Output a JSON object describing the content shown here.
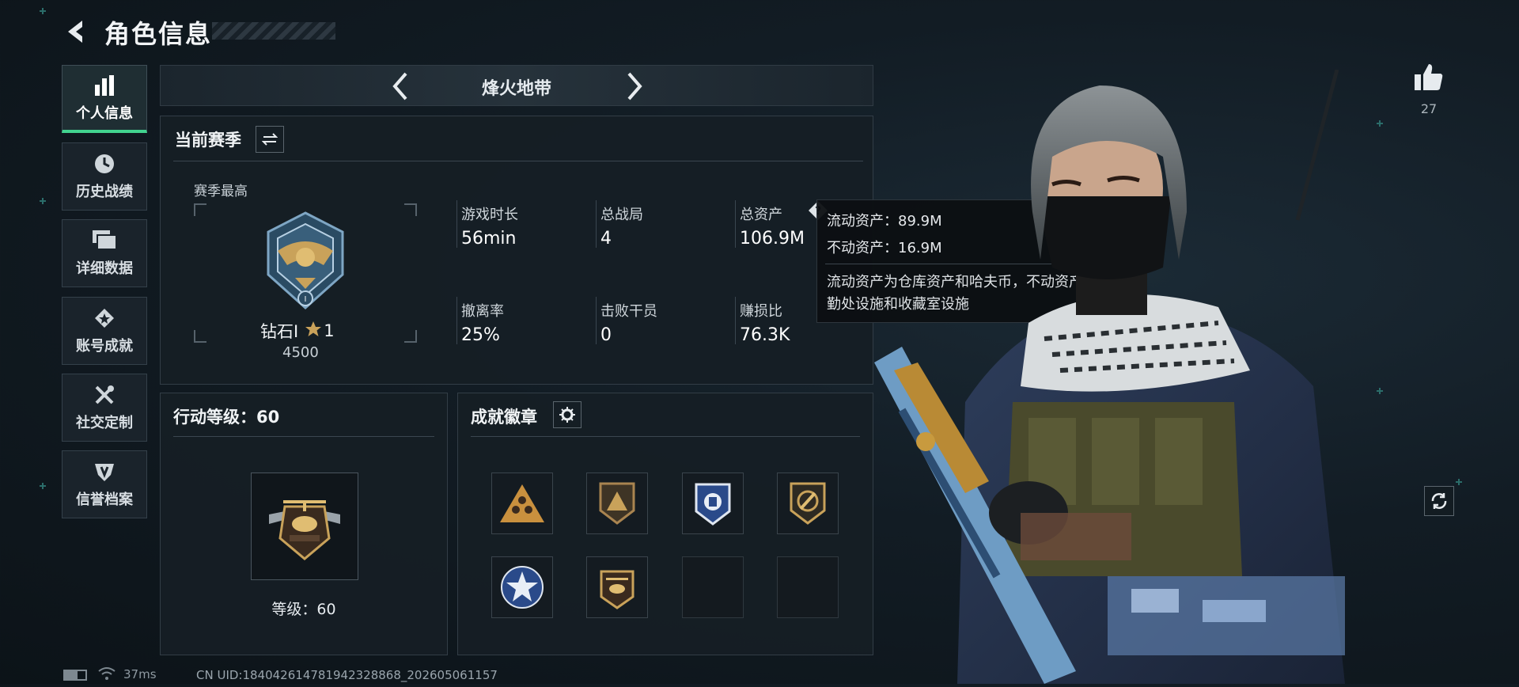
{
  "header": {
    "title": "角色信息"
  },
  "nav": {
    "items": [
      {
        "label": "个人信息",
        "icon": "bar-chart-icon",
        "active": true
      },
      {
        "label": "历史战绩",
        "icon": "history-clock-icon",
        "active": false
      },
      {
        "label": "详细数据",
        "icon": "folder-icon",
        "active": false
      },
      {
        "label": "账号成就",
        "icon": "achievement-icon",
        "active": false
      },
      {
        "label": "社交定制",
        "icon": "tools-icon",
        "active": false
      },
      {
        "label": "信誉档案",
        "icon": "shield-icon",
        "active": false
      }
    ]
  },
  "mode": {
    "title": "烽火地带"
  },
  "season": {
    "title": "当前赛季",
    "best_label": "赛季最高",
    "rank_name": "钻石I",
    "stars": "1",
    "score": "4500",
    "stats": [
      {
        "label": "游戏时长",
        "value": "56min"
      },
      {
        "label": "总战局",
        "value": "4"
      },
      {
        "label": "总资产",
        "value": "106.9M"
      },
      {
        "label": "撤离率",
        "value": "25%"
      },
      {
        "label": "击败干员",
        "value": "0"
      },
      {
        "label": "赚损比",
        "value": "76.3K"
      }
    ]
  },
  "tooltip": {
    "liquid": "流动资产：89.9M",
    "fixed": "不动资产：16.9M",
    "desc": "流动资产为仓库资产和哈夫币，不动资产为特勤处设施和收藏室设施"
  },
  "action_level": {
    "title": "行动等级：60",
    "level_label": "等级：60"
  },
  "badges": {
    "title": "成就徽章",
    "slots": [
      {
        "icon": "triangle-squad-badge-icon",
        "filled": true
      },
      {
        "icon": "pyramid-badge-icon",
        "filled": true
      },
      {
        "icon": "police-shield-badge-icon",
        "filled": true
      },
      {
        "icon": "bullet-shield-badge-icon",
        "filled": true
      },
      {
        "icon": "star-emblem-badge-icon",
        "filled": true
      },
      {
        "icon": "helicopter-badge-icon",
        "filled": true
      },
      {
        "icon": "",
        "filled": false
      },
      {
        "icon": "",
        "filled": false
      }
    ]
  },
  "likes": {
    "count": "27"
  },
  "status": {
    "ping": "37ms",
    "uid": "CN UID:18404261478194232886​8_202605061157"
  },
  "colors": {
    "accent": "#42d38f",
    "gold": "#c9a25a",
    "panel": "#161e25"
  }
}
